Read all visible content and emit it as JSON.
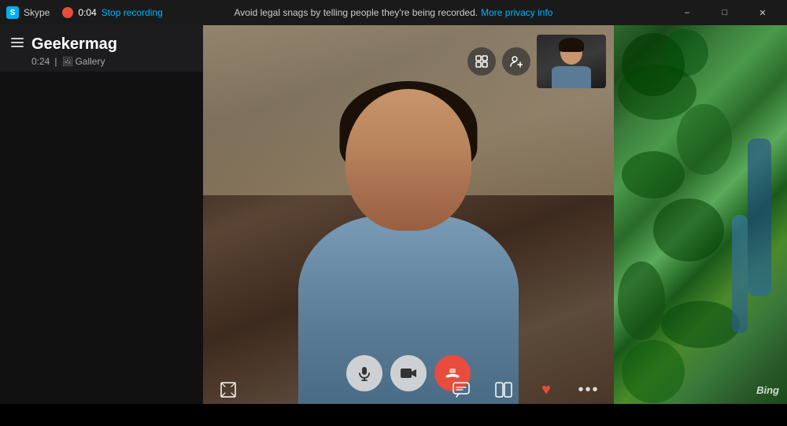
{
  "titlebar": {
    "app_name": "Skype",
    "app_icon": "S",
    "timer": "0:04",
    "stop_recording_label": "Stop recording",
    "minimize_label": "–",
    "maximize_label": "□",
    "close_label": "✕"
  },
  "notif_bar": {
    "message": "Avoid legal snags by telling people they're being recorded.",
    "link_label": "More privacy info"
  },
  "sidebar": {
    "menu_label": "Menu",
    "contact_name": "Geekermag",
    "call_time": "0:24",
    "gallery_label": "Gallery"
  },
  "video": {
    "top_controls": {
      "layout_icon": "⊞",
      "add_person_icon": "👤+"
    },
    "bottom_controls": {
      "fullscreen_icon": "⛶",
      "mic_icon": "🎤",
      "camera_icon": "📷",
      "end_call_icon": "📞",
      "chat_icon": "💬",
      "switch_icon": "⧉",
      "heart_icon": "♥",
      "more_icon": "•••"
    }
  },
  "bing": {
    "logo": "Bing"
  }
}
